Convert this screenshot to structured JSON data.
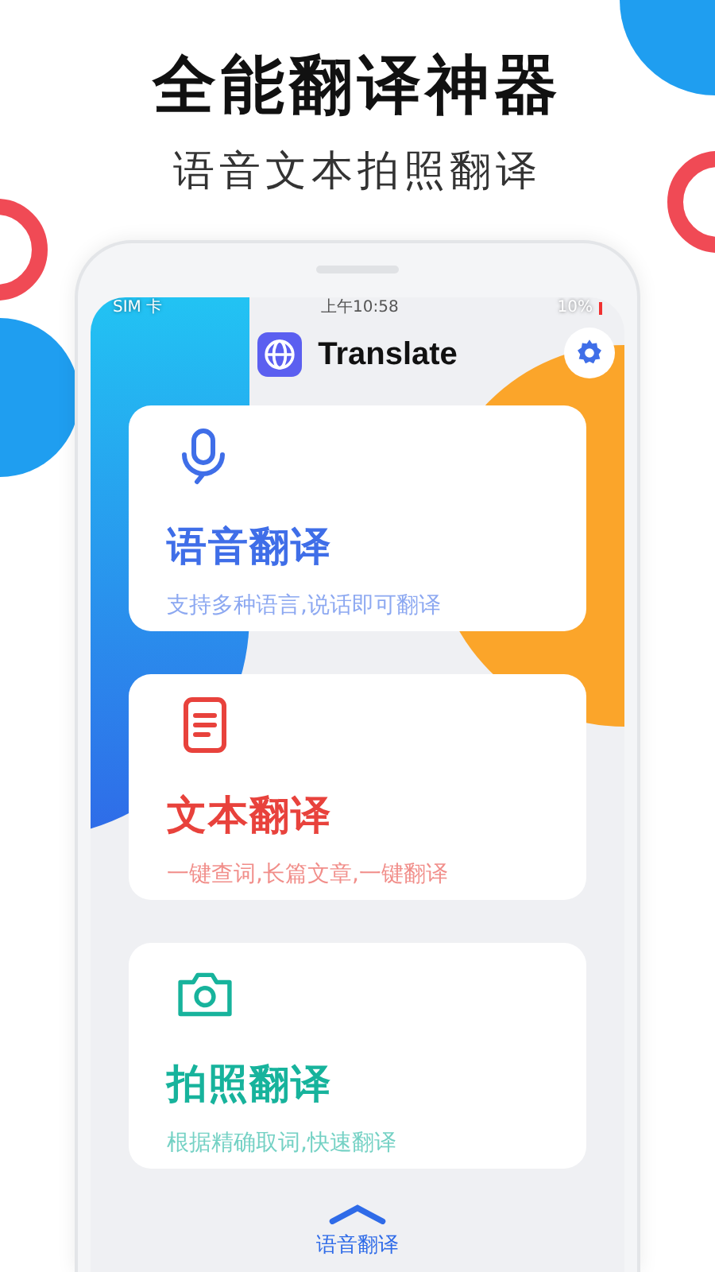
{
  "headline": "全能翻译神器",
  "subtitle": "语音文本拍照翻译",
  "status_bar": {
    "carrier": "SIM 卡",
    "time": "上午10:58",
    "battery": "10%"
  },
  "app_header": {
    "title": "Translate"
  },
  "cards": [
    {
      "kind": "voice",
      "title": "语音翻译",
      "description": "支持多种语言,说话即可翻译",
      "color": "#3f6ee8"
    },
    {
      "kind": "text",
      "title": "文本翻译",
      "description": "一键查词,长篇文章,一键翻译",
      "color": "#e8423c"
    },
    {
      "kind": "photo",
      "title": "拍照翻译",
      "description": "根据精确取词,快速翻译",
      "color": "#17b39c"
    }
  ],
  "bottom_nav": {
    "label": "语音翻译"
  }
}
